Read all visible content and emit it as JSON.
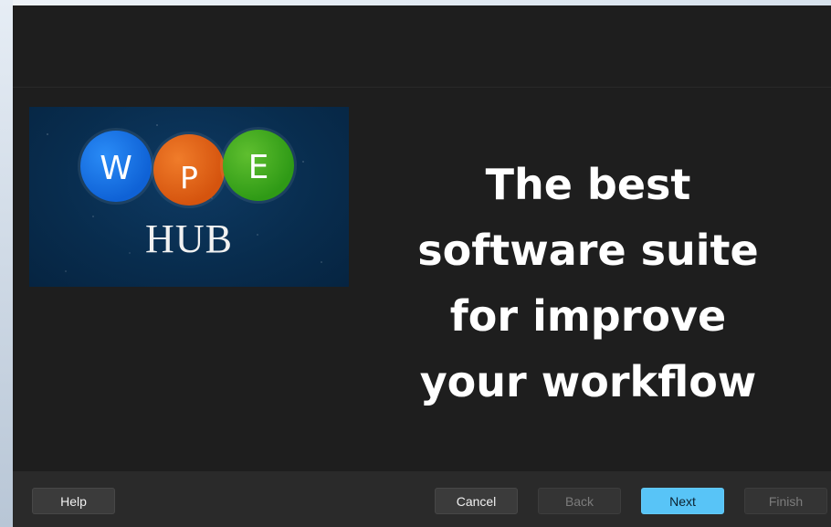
{
  "logo": {
    "letters": [
      "W",
      "P",
      "E"
    ],
    "hub_text": "HUB"
  },
  "tagline": {
    "lines": [
      "The best",
      "software suite",
      "for improve",
      "your workflow"
    ]
  },
  "footer": {
    "help_label": "Help",
    "cancel_label": "Cancel",
    "back_label": "Back",
    "next_label": "Next",
    "finish_label": "Finish"
  },
  "colors": {
    "dialog_background": "#1e1e1e",
    "footer_background": "#2a2a2a",
    "accent": "#58c4f7",
    "logo_blue": "#0f62d6",
    "logo_orange": "#d5540e",
    "logo_green": "#2f9a16",
    "logo_background": "#082c4d"
  }
}
